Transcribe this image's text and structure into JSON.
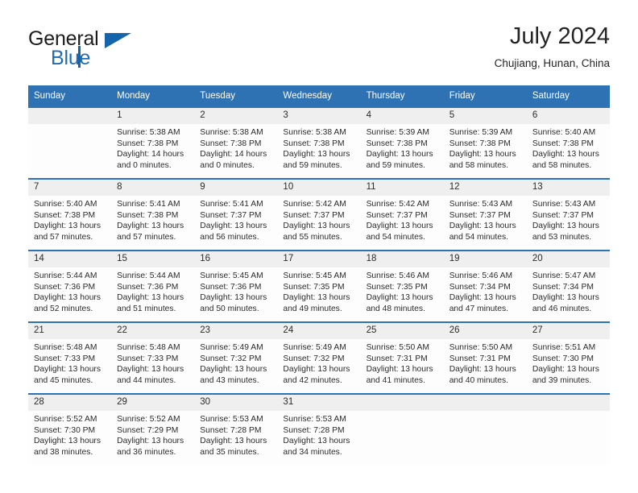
{
  "brand": {
    "name_part1": "General",
    "name_part2": "Blue",
    "accent_color": "#1565ad",
    "triangle_icon": "triangle-icon"
  },
  "header": {
    "title": "July 2024",
    "subtitle": "Chujiang, Hunan, China"
  },
  "theme": {
    "header_blue": "#2e72b3",
    "row_divider_blue": "#2e72b3",
    "daynum_band": "#efefef",
    "cell_bg": "#fdfdfd",
    "text": "#2b2b2b"
  },
  "calendar": {
    "weekday_headers": [
      "Sunday",
      "Monday",
      "Tuesday",
      "Wednesday",
      "Thursday",
      "Friday",
      "Saturday"
    ],
    "labels": {
      "sunrise_prefix": "Sunrise:",
      "sunset_prefix": "Sunset:",
      "daylight_prefix": "Daylight:"
    },
    "weeks": [
      [
        {
          "day": "",
          "empty": true,
          "l1": "",
          "l2": "",
          "l3": "",
          "l4": ""
        },
        {
          "day": "1",
          "l1": "Sunrise: 5:38 AM",
          "l2": "Sunset: 7:38 PM",
          "l3": "Daylight: 14 hours",
          "l4": "and 0 minutes."
        },
        {
          "day": "2",
          "l1": "Sunrise: 5:38 AM",
          "l2": "Sunset: 7:38 PM",
          "l3": "Daylight: 14 hours",
          "l4": "and 0 minutes."
        },
        {
          "day": "3",
          "l1": "Sunrise: 5:38 AM",
          "l2": "Sunset: 7:38 PM",
          "l3": "Daylight: 13 hours",
          "l4": "and 59 minutes."
        },
        {
          "day": "4",
          "l1": "Sunrise: 5:39 AM",
          "l2": "Sunset: 7:38 PM",
          "l3": "Daylight: 13 hours",
          "l4": "and 59 minutes."
        },
        {
          "day": "5",
          "l1": "Sunrise: 5:39 AM",
          "l2": "Sunset: 7:38 PM",
          "l3": "Daylight: 13 hours",
          "l4": "and 58 minutes."
        },
        {
          "day": "6",
          "l1": "Sunrise: 5:40 AM",
          "l2": "Sunset: 7:38 PM",
          "l3": "Daylight: 13 hours",
          "l4": "and 58 minutes."
        }
      ],
      [
        {
          "day": "7",
          "l1": "Sunrise: 5:40 AM",
          "l2": "Sunset: 7:38 PM",
          "l3": "Daylight: 13 hours",
          "l4": "and 57 minutes."
        },
        {
          "day": "8",
          "l1": "Sunrise: 5:41 AM",
          "l2": "Sunset: 7:38 PM",
          "l3": "Daylight: 13 hours",
          "l4": "and 57 minutes."
        },
        {
          "day": "9",
          "l1": "Sunrise: 5:41 AM",
          "l2": "Sunset: 7:37 PM",
          "l3": "Daylight: 13 hours",
          "l4": "and 56 minutes."
        },
        {
          "day": "10",
          "l1": "Sunrise: 5:42 AM",
          "l2": "Sunset: 7:37 PM",
          "l3": "Daylight: 13 hours",
          "l4": "and 55 minutes."
        },
        {
          "day": "11",
          "l1": "Sunrise: 5:42 AM",
          "l2": "Sunset: 7:37 PM",
          "l3": "Daylight: 13 hours",
          "l4": "and 54 minutes."
        },
        {
          "day": "12",
          "l1": "Sunrise: 5:43 AM",
          "l2": "Sunset: 7:37 PM",
          "l3": "Daylight: 13 hours",
          "l4": "and 54 minutes."
        },
        {
          "day": "13",
          "l1": "Sunrise: 5:43 AM",
          "l2": "Sunset: 7:37 PM",
          "l3": "Daylight: 13 hours",
          "l4": "and 53 minutes."
        }
      ],
      [
        {
          "day": "14",
          "l1": "Sunrise: 5:44 AM",
          "l2": "Sunset: 7:36 PM",
          "l3": "Daylight: 13 hours",
          "l4": "and 52 minutes."
        },
        {
          "day": "15",
          "l1": "Sunrise: 5:44 AM",
          "l2": "Sunset: 7:36 PM",
          "l3": "Daylight: 13 hours",
          "l4": "and 51 minutes."
        },
        {
          "day": "16",
          "l1": "Sunrise: 5:45 AM",
          "l2": "Sunset: 7:36 PM",
          "l3": "Daylight: 13 hours",
          "l4": "and 50 minutes."
        },
        {
          "day": "17",
          "l1": "Sunrise: 5:45 AM",
          "l2": "Sunset: 7:35 PM",
          "l3": "Daylight: 13 hours",
          "l4": "and 49 minutes."
        },
        {
          "day": "18",
          "l1": "Sunrise: 5:46 AM",
          "l2": "Sunset: 7:35 PM",
          "l3": "Daylight: 13 hours",
          "l4": "and 48 minutes."
        },
        {
          "day": "19",
          "l1": "Sunrise: 5:46 AM",
          "l2": "Sunset: 7:34 PM",
          "l3": "Daylight: 13 hours",
          "l4": "and 47 minutes."
        },
        {
          "day": "20",
          "l1": "Sunrise: 5:47 AM",
          "l2": "Sunset: 7:34 PM",
          "l3": "Daylight: 13 hours",
          "l4": "and 46 minutes."
        }
      ],
      [
        {
          "day": "21",
          "l1": "Sunrise: 5:48 AM",
          "l2": "Sunset: 7:33 PM",
          "l3": "Daylight: 13 hours",
          "l4": "and 45 minutes."
        },
        {
          "day": "22",
          "l1": "Sunrise: 5:48 AM",
          "l2": "Sunset: 7:33 PM",
          "l3": "Daylight: 13 hours",
          "l4": "and 44 minutes."
        },
        {
          "day": "23",
          "l1": "Sunrise: 5:49 AM",
          "l2": "Sunset: 7:32 PM",
          "l3": "Daylight: 13 hours",
          "l4": "and 43 minutes."
        },
        {
          "day": "24",
          "l1": "Sunrise: 5:49 AM",
          "l2": "Sunset: 7:32 PM",
          "l3": "Daylight: 13 hours",
          "l4": "and 42 minutes."
        },
        {
          "day": "25",
          "l1": "Sunrise: 5:50 AM",
          "l2": "Sunset: 7:31 PM",
          "l3": "Daylight: 13 hours",
          "l4": "and 41 minutes."
        },
        {
          "day": "26",
          "l1": "Sunrise: 5:50 AM",
          "l2": "Sunset: 7:31 PM",
          "l3": "Daylight: 13 hours",
          "l4": "and 40 minutes."
        },
        {
          "day": "27",
          "l1": "Sunrise: 5:51 AM",
          "l2": "Sunset: 7:30 PM",
          "l3": "Daylight: 13 hours",
          "l4": "and 39 minutes."
        }
      ],
      [
        {
          "day": "28",
          "l1": "Sunrise: 5:52 AM",
          "l2": "Sunset: 7:30 PM",
          "l3": "Daylight: 13 hours",
          "l4": "and 38 minutes."
        },
        {
          "day": "29",
          "l1": "Sunrise: 5:52 AM",
          "l2": "Sunset: 7:29 PM",
          "l3": "Daylight: 13 hours",
          "l4": "and 36 minutes."
        },
        {
          "day": "30",
          "l1": "Sunrise: 5:53 AM",
          "l2": "Sunset: 7:28 PM",
          "l3": "Daylight: 13 hours",
          "l4": "and 35 minutes."
        },
        {
          "day": "31",
          "l1": "Sunrise: 5:53 AM",
          "l2": "Sunset: 7:28 PM",
          "l3": "Daylight: 13 hours",
          "l4": "and 34 minutes."
        },
        {
          "day": "",
          "empty": true,
          "l1": "",
          "l2": "",
          "l3": "",
          "l4": ""
        },
        {
          "day": "",
          "empty": true,
          "l1": "",
          "l2": "",
          "l3": "",
          "l4": ""
        },
        {
          "day": "",
          "empty": true,
          "l1": "",
          "l2": "",
          "l3": "",
          "l4": ""
        }
      ]
    ]
  }
}
